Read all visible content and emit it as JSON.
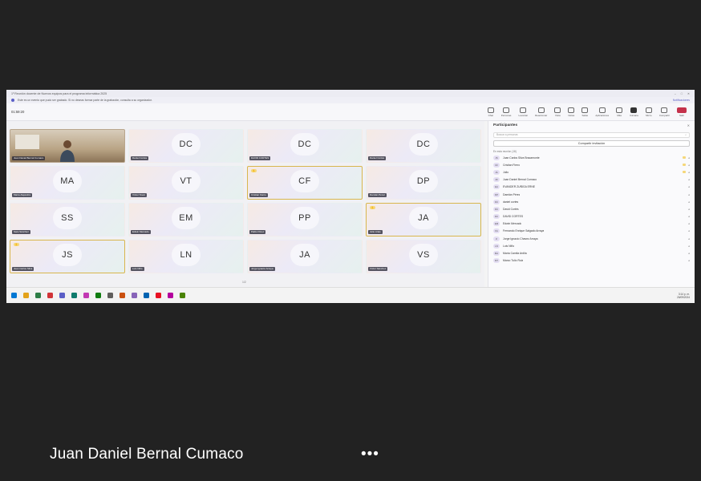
{
  "window": {
    "title": "1º Reunión docente de Nuevos equipos para el programa informática 2025",
    "info": "Este es un evento que pudo ser grabado. Si no deseas formar parte de la grabación, consulta a su organizador.",
    "info_action": "Notificaciones",
    "timer": "01:59:20"
  },
  "toolbar": {
    "items": [
      {
        "label": "Chat",
        "icon": "chat-icon"
      },
      {
        "label": "Personas",
        "icon": "people-icon"
      },
      {
        "label": "Levantar",
        "icon": "hand-icon"
      },
      {
        "label": "Reaccionar",
        "icon": "react-icon"
      },
      {
        "label": "Vista",
        "icon": "view-icon"
      },
      {
        "label": "Notas",
        "icon": "notes-icon"
      },
      {
        "label": "Salas",
        "icon": "rooms-icon"
      },
      {
        "label": "Aplicaciones",
        "icon": "apps-icon"
      },
      {
        "label": "Más",
        "icon": "more-icon"
      },
      {
        "label": "Cámara",
        "icon": "camera-icon"
      },
      {
        "label": "Micro",
        "icon": "mic-icon"
      },
      {
        "label": "Compartir",
        "icon": "share-icon"
      },
      {
        "label": "Salir",
        "icon": "leave-icon"
      }
    ]
  },
  "grid": {
    "tiles": [
      {
        "initials": "",
        "name": "Juan Daniel Bernal Cumaco",
        "video": true,
        "hand": false,
        "speaking": false
      },
      {
        "initials": "DC",
        "name": "Daniel Cortés",
        "video": false,
        "hand": false,
        "speaking": false
      },
      {
        "initials": "DC",
        "name": "DAVID CORTES",
        "video": false,
        "hand": false,
        "speaking": false
      },
      {
        "initials": "DC",
        "name": "Daniel Cortés",
        "video": false,
        "hand": false,
        "speaking": false
      },
      {
        "initials": "MA",
        "name": "María Alejandra",
        "video": false,
        "hand": false,
        "speaking": false
      },
      {
        "initials": "VT",
        "name": "Víctor Tovar",
        "video": false,
        "hand": false,
        "speaking": false
      },
      {
        "initials": "CF",
        "name": "Cristian Fierro",
        "video": false,
        "hand": true,
        "speaking": true
      },
      {
        "initials": "DP",
        "name": "Damián Pérez",
        "video": false,
        "hand": false,
        "speaking": false
      },
      {
        "initials": "SS",
        "name": "Sara Sánchez",
        "video": false,
        "hand": false,
        "speaking": false
      },
      {
        "initials": "EM",
        "name": "Edwin Mercado",
        "video": false,
        "hand": false,
        "speaking": false
      },
      {
        "initials": "PP",
        "name": "Pablo Pérez",
        "video": false,
        "hand": false,
        "speaking": false
      },
      {
        "initials": "JA",
        "name": "Julio Arias",
        "video": false,
        "hand": true,
        "speaking": true
      },
      {
        "initials": "JS",
        "name": "Juan Carlos Silva",
        "video": false,
        "hand": true,
        "speaking": true
      },
      {
        "initials": "LN",
        "name": "Luis Niño",
        "video": false,
        "hand": false,
        "speaking": false
      },
      {
        "initials": "JA",
        "name": "Jorge Ignacio Arraya",
        "video": false,
        "hand": false,
        "speaking": false
      },
      {
        "initials": "VS",
        "name": "Víctor Sánchez",
        "video": false,
        "hand": false,
        "speaking": false
      }
    ],
    "page_indicator": "1/2"
  },
  "panel": {
    "title": "Participantes",
    "search_placeholder": "Buscar a personas",
    "share_label": "Compartir invitación",
    "section_label": "En esta reunión (18)",
    "participants": [
      {
        "initials": "JS",
        "name": "Juan Carlos Silva Bracamonte",
        "hand": true
      },
      {
        "initials": "CF",
        "name": "Cristian Fierro",
        "hand": true
      },
      {
        "initials": "JA",
        "name": "Julio",
        "hand": true
      },
      {
        "initials": "JD",
        "name": "Juan Daniel Bernal Cumaco",
        "hand": false
      },
      {
        "initials": "EA",
        "name": "EVANDER ZUÑIGA ERNE",
        "hand": false
      },
      {
        "initials": "DP",
        "name": "Damián Pérez",
        "hand": false
      },
      {
        "initials": "DC",
        "name": "daniel cortes",
        "hand": false
      },
      {
        "initials": "DC",
        "name": "David Cortés",
        "hand": false
      },
      {
        "initials": "DC",
        "name": "DAVID CORTES",
        "hand": false
      },
      {
        "initials": "EM",
        "name": "Edwin Mercado",
        "hand": false
      },
      {
        "initials": "FA",
        "name": "Fernando Enrique Salgado Arraya",
        "hand": false
      },
      {
        "initials": "JI",
        "name": "Jorge Ignacio Chavez Arraya",
        "hand": false
      },
      {
        "initials": "LN",
        "name": "Luis Niño",
        "hand": false
      },
      {
        "initials": "MA",
        "name": "María Camila Ardila",
        "hand": false
      },
      {
        "initials": "MT",
        "name": "Marco Tulio Ruiz",
        "hand": false
      }
    ]
  },
  "taskbar": {
    "icons": [
      "#0078d4",
      "#e3a21a",
      "#2d7d46",
      "#d13438",
      "#5b5fc7",
      "#0f7b6c",
      "#c239b3",
      "#107c10",
      "#605e5c",
      "#ca5010",
      "#8764b8",
      "#0063b1",
      "#e81123",
      "#b4009e",
      "#498205"
    ],
    "tray": "3:14 p. m.\n26/09/2024"
  },
  "caption": {
    "name": "Juan Daniel Bernal Cumaco",
    "more": "•••"
  }
}
